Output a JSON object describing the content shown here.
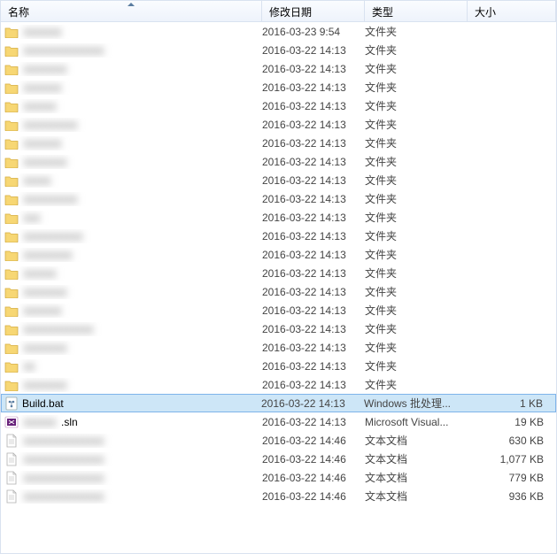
{
  "columns": {
    "name": "名称",
    "date": "修改日期",
    "type": "类型",
    "size": "大小"
  },
  "file_types": {
    "folder": "文件夹",
    "bat": "Windows 批处理...",
    "sln": "Microsoft Visual...",
    "txt": "文本文档"
  },
  "rows": [
    {
      "icon": "folder",
      "name_hidden": true,
      "name": "xxxxxxx",
      "date": "2016-03-23 9:54",
      "type": "文件夹",
      "size": ""
    },
    {
      "icon": "folder",
      "name_hidden": true,
      "name": "xxxxxxxxxxxxxxx",
      "date": "2016-03-22 14:13",
      "type": "文件夹",
      "size": ""
    },
    {
      "icon": "folder",
      "name_hidden": true,
      "name": "xxxxxxxx",
      "date": "2016-03-22 14:13",
      "type": "文件夹",
      "size": ""
    },
    {
      "icon": "folder",
      "name_hidden": true,
      "name": "xxxxxxx",
      "date": "2016-03-22 14:13",
      "type": "文件夹",
      "size": ""
    },
    {
      "icon": "folder",
      "name_hidden": true,
      "name": "xxxxxx",
      "date": "2016-03-22 14:13",
      "type": "文件夹",
      "size": ""
    },
    {
      "icon": "folder",
      "name_hidden": true,
      "name": "xxxxxxxxxx",
      "date": "2016-03-22 14:13",
      "type": "文件夹",
      "size": ""
    },
    {
      "icon": "folder",
      "name_hidden": true,
      "name": "xxxxxxx",
      "date": "2016-03-22 14:13",
      "type": "文件夹",
      "size": ""
    },
    {
      "icon": "folder",
      "name_hidden": true,
      "name": "xxxxxxxx",
      "date": "2016-03-22 14:13",
      "type": "文件夹",
      "size": ""
    },
    {
      "icon": "folder",
      "name_hidden": true,
      "name": "xxxxx",
      "date": "2016-03-22 14:13",
      "type": "文件夹",
      "size": ""
    },
    {
      "icon": "folder",
      "name_hidden": true,
      "name": "xxxxxxxxxx",
      "date": "2016-03-22 14:13",
      "type": "文件夹",
      "size": ""
    },
    {
      "icon": "folder",
      "name_hidden": true,
      "name": "xxx",
      "date": "2016-03-22 14:13",
      "type": "文件夹",
      "size": ""
    },
    {
      "icon": "folder",
      "name_hidden": true,
      "name": "xxxxxxxxxxx",
      "date": "2016-03-22 14:13",
      "type": "文件夹",
      "size": ""
    },
    {
      "icon": "folder",
      "name_hidden": true,
      "name": "xxxxxxxxx",
      "date": "2016-03-22 14:13",
      "type": "文件夹",
      "size": ""
    },
    {
      "icon": "folder",
      "name_hidden": true,
      "name": "xxxxxx",
      "date": "2016-03-22 14:13",
      "type": "文件夹",
      "size": ""
    },
    {
      "icon": "folder",
      "name_hidden": true,
      "name": "xxxxxxxx",
      "date": "2016-03-22 14:13",
      "type": "文件夹",
      "size": ""
    },
    {
      "icon": "folder",
      "name_hidden": true,
      "name": "xxxxxxx",
      "date": "2016-03-22 14:13",
      "type": "文件夹",
      "size": ""
    },
    {
      "icon": "folder",
      "name_hidden": true,
      "name": "xxxxxxxxxxxxx",
      "date": "2016-03-22 14:13",
      "type": "文件夹",
      "size": ""
    },
    {
      "icon": "folder",
      "name_hidden": true,
      "name": "xxxxxxxx",
      "date": "2016-03-22 14:13",
      "type": "文件夹",
      "size": ""
    },
    {
      "icon": "folder",
      "name_hidden": true,
      "name": "xx",
      "date": "2016-03-22 14:13",
      "type": "文件夹",
      "size": ""
    },
    {
      "icon": "folder",
      "name_hidden": true,
      "name": "xxxxxxxx",
      "date": "2016-03-22 14:13",
      "type": "文件夹",
      "size": ""
    },
    {
      "icon": "bat",
      "name_hidden": false,
      "name": "Build.bat",
      "date": "2016-03-22 14:13",
      "type": "Windows 批处理...",
      "size": "1 KB",
      "selected": true
    },
    {
      "icon": "sln",
      "name_hidden": true,
      "name": "xxxxxx",
      "suffix": ".sln",
      "date": "2016-03-22 14:13",
      "type": "Microsoft Visual...",
      "size": "19 KB"
    },
    {
      "icon": "txt",
      "name_hidden": true,
      "name": "xxxxxxxxxxxxxxx",
      "date": "2016-03-22 14:46",
      "type": "文本文档",
      "size": "630 KB"
    },
    {
      "icon": "txt",
      "name_hidden": true,
      "name": "xxxxxxxxxxxxxxx",
      "date": "2016-03-22 14:46",
      "type": "文本文档",
      "size": "1,077 KB"
    },
    {
      "icon": "txt",
      "name_hidden": true,
      "name": "xxxxxxxxxxxxxxx",
      "date": "2016-03-22 14:46",
      "type": "文本文档",
      "size": "779 KB"
    },
    {
      "icon": "txt",
      "name_hidden": true,
      "name": "xxxxxxxxxxxxxxx",
      "date": "2016-03-22 14:46",
      "type": "文本文档",
      "size": "936 KB"
    }
  ]
}
